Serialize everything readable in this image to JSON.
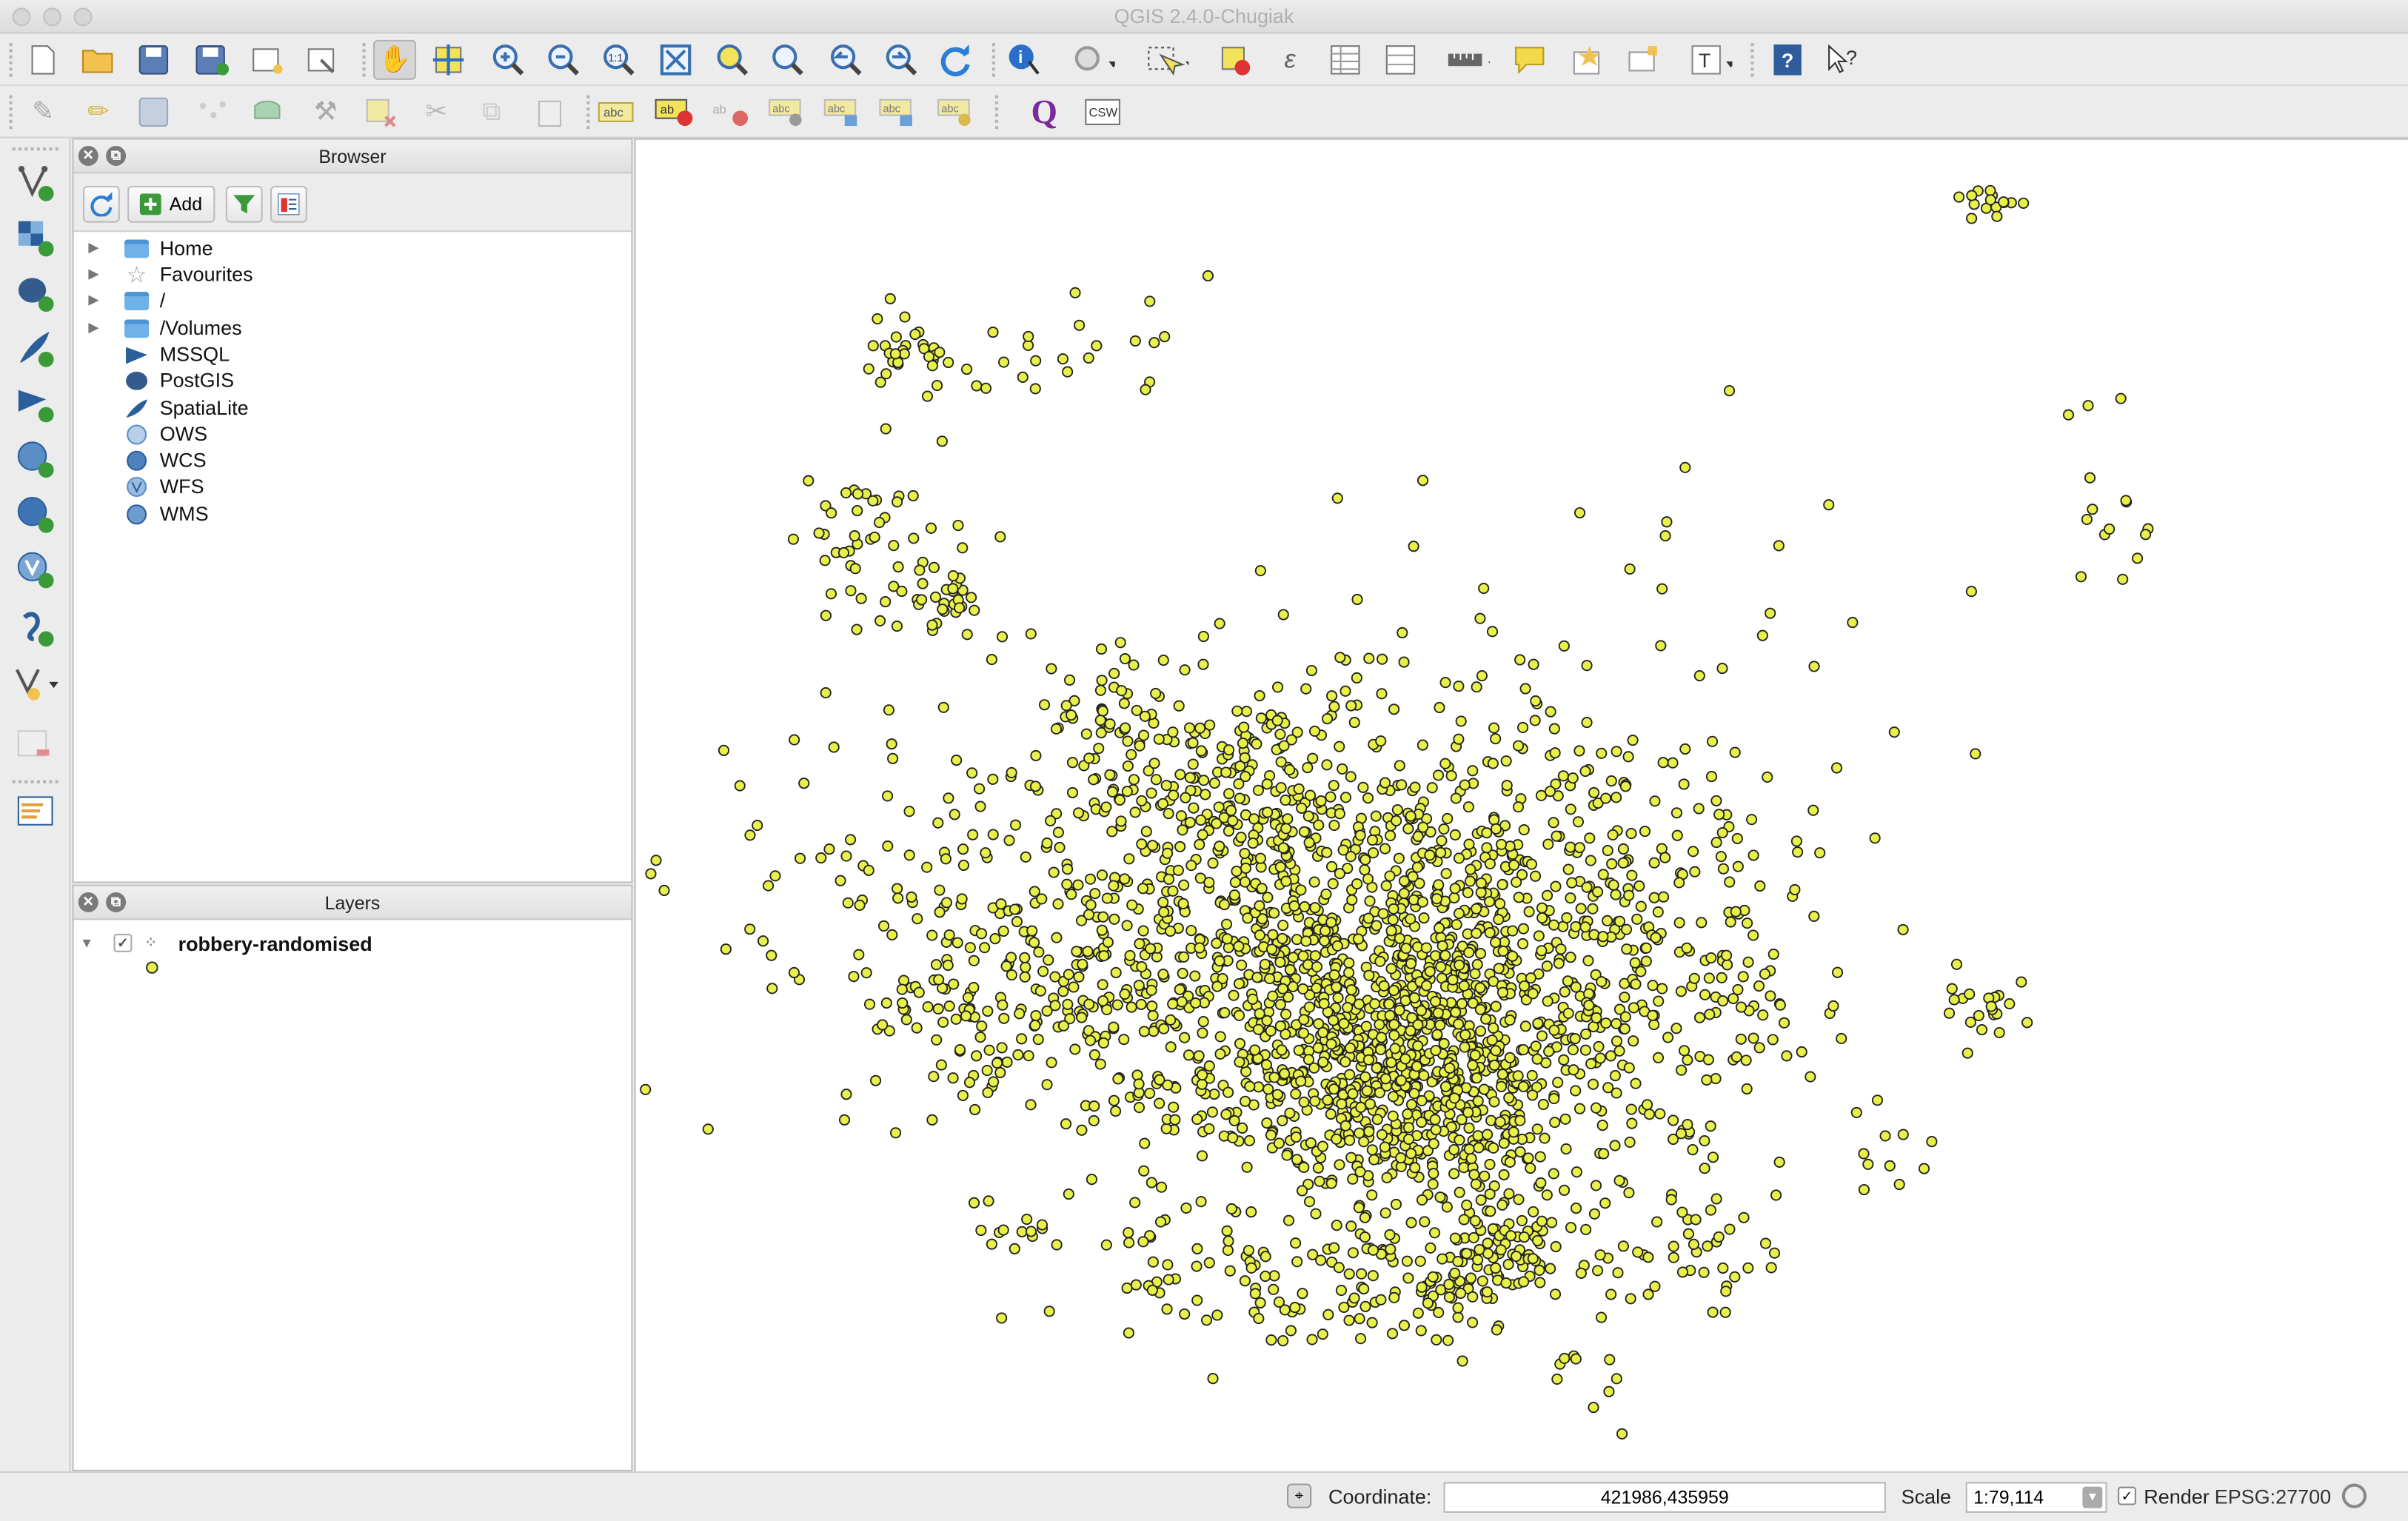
{
  "window": {
    "title": "QGIS 2.4.0-Chugiak"
  },
  "browser_panel": {
    "title": "Browser",
    "add_label": "Add",
    "items": [
      {
        "label": "Home",
        "icon": "folder-icon",
        "expandable": true
      },
      {
        "label": "Favourites",
        "icon": "star-icon",
        "expandable": true
      },
      {
        "label": "/",
        "icon": "folder-icon",
        "expandable": true
      },
      {
        "label": "/Volumes",
        "icon": "folder-icon",
        "expandable": true
      },
      {
        "label": "MSSQL",
        "icon": "mssql-icon",
        "expandable": false
      },
      {
        "label": "PostGIS",
        "icon": "postgis-elephant-icon",
        "expandable": false
      },
      {
        "label": "SpatiaLite",
        "icon": "spatialite-feather-icon",
        "expandable": false
      },
      {
        "label": "OWS",
        "icon": "globe-icon",
        "expandable": false
      },
      {
        "label": "WCS",
        "icon": "globe-icon",
        "expandable": false
      },
      {
        "label": "WFS",
        "icon": "globe-icon",
        "expandable": false
      },
      {
        "label": "WMS",
        "icon": "globe-icon",
        "expandable": false
      }
    ]
  },
  "layers_panel": {
    "title": "Layers",
    "layers": [
      {
        "name": "robbery-randomised",
        "visible": true,
        "symbol_color": "#e8f04a"
      }
    ]
  },
  "map": {
    "background": "#ffffff",
    "point_fill": "#e8f04a",
    "point_stroke": "#222222"
  },
  "statusbar": {
    "coordinate_label": "Coordinate:",
    "coordinate_value": "421986,435959",
    "scale_label": "Scale",
    "scale_value": "1:79,114",
    "render_label": "Render",
    "render_checked": true,
    "crs": "EPSG:27700"
  }
}
